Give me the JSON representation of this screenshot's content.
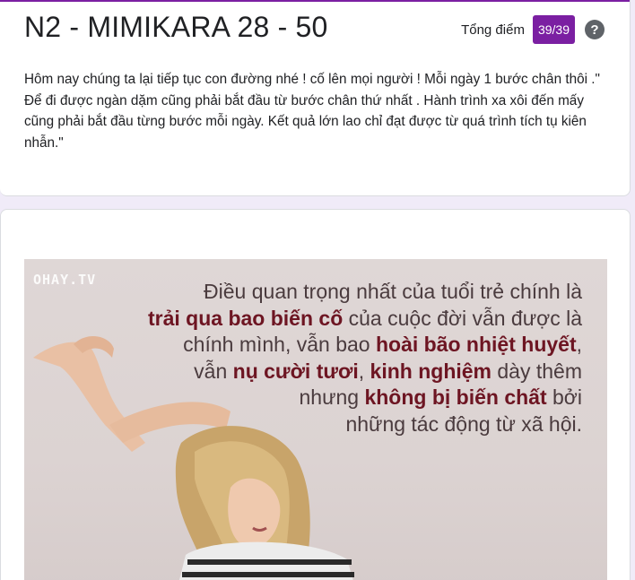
{
  "form": {
    "title": "N2 - MIMIKARA 28 - 50",
    "score_label": "Tổng điểm",
    "score_value": "39/39",
    "help_icon": "question-mark-icon",
    "description": "Hôm nay chúng ta lại tiếp tục con đường nhé ! cố lên mọi người ! Mỗi ngày 1 bước chân thôi .\"  Để đi được ngàn dặm cũng phải bắt đầu từ bước chân thứ nhất . Hành trình xa xôi đến mấy cũng phải bắt đầu từng bước mỗi ngày. Kết quả lớn lao chỉ đạt được từ quá trình tích tụ kiên nhẫn.\""
  },
  "image": {
    "watermark": "OHAY.TV",
    "quote_lines": [
      [
        {
          "t": "Điều quan trọng nhất của tuổi trẻ chính là",
          "b": false
        }
      ],
      [
        {
          "t": "trải qua bao biến cố",
          "b": true
        },
        {
          "t": " của cuộc đời vẫn được là",
          "b": false
        }
      ],
      [
        {
          "t": "chính mình, vẫn bao ",
          "b": false
        },
        {
          "t": "hoài bão nhiệt huyết",
          "b": true
        },
        {
          "t": ",",
          "b": false
        }
      ],
      [
        {
          "t": "vẫn ",
          "b": false
        },
        {
          "t": "nụ cười tươi",
          "b": true
        },
        {
          "t": ", ",
          "b": false
        },
        {
          "t": "kinh nghiệm",
          "b": true
        },
        {
          "t": " dày thêm",
          "b": false
        }
      ],
      [
        {
          "t": "nhưng ",
          "b": false
        },
        {
          "t": "không bị biến chất",
          "b": true
        },
        {
          "t": " bởi",
          "b": false
        }
      ],
      [
        {
          "t": "những tác động từ xã hội.",
          "b": false
        }
      ]
    ]
  },
  "colors": {
    "accent": "#7b1fa2",
    "background": "#f0ebf8",
    "quote_bold": "#6d1522"
  }
}
